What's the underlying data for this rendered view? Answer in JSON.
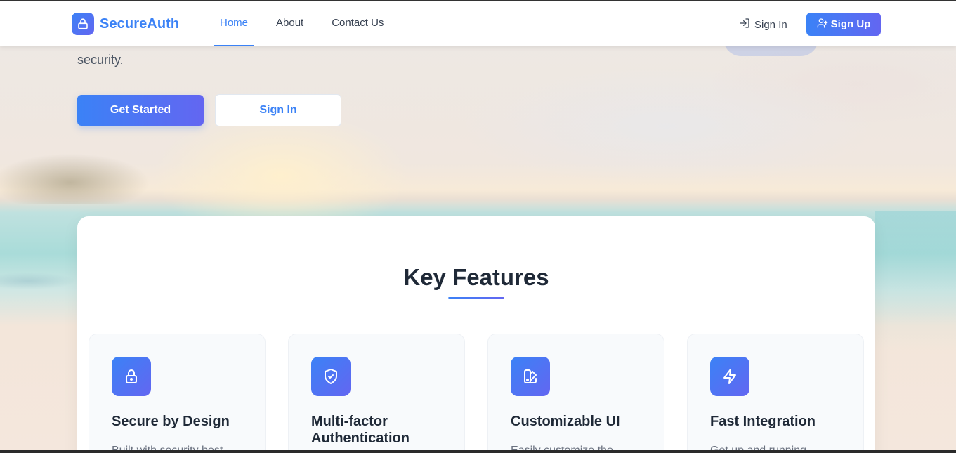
{
  "brand": {
    "name": "SecureAuth"
  },
  "nav": {
    "links": [
      {
        "label": "Home",
        "active": true
      },
      {
        "label": "About",
        "active": false
      },
      {
        "label": "Contact Us",
        "active": false
      }
    ],
    "signin_label": "Sign In",
    "signup_label": "Sign Up"
  },
  "hero": {
    "description_tail": "security.",
    "primary_cta": "Get Started",
    "secondary_cta": "Sign In"
  },
  "features": {
    "title": "Key Features",
    "items": [
      {
        "icon": "lock-icon",
        "title": "Secure by Design",
        "description": "Built with security best"
      },
      {
        "icon": "shield-check-icon",
        "title": "Multi-factor Authentication",
        "description": ""
      },
      {
        "icon": "palette-icon",
        "title": "Customizable UI",
        "description": "Easily customize the"
      },
      {
        "icon": "lightning-icon",
        "title": "Fast Integration",
        "description": "Get up and running"
      }
    ]
  },
  "colors": {
    "accent": "#3b82f6",
    "accent_gradient_end": "#6366f1",
    "heading": "#1f2937",
    "body_text": "#6b7280"
  }
}
